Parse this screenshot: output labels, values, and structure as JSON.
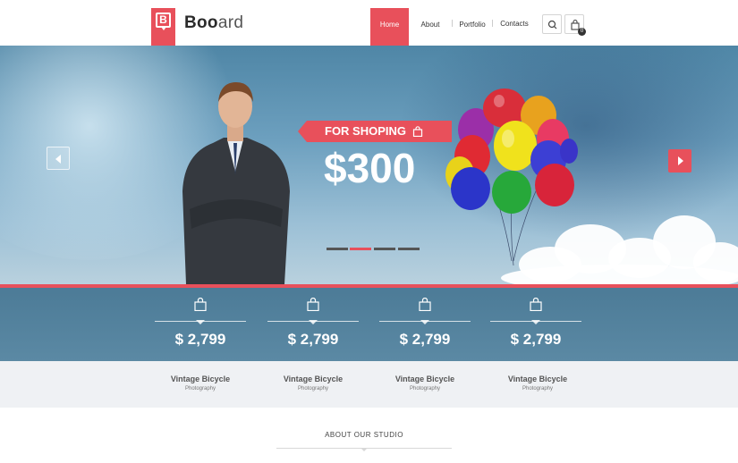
{
  "brand": {
    "name_bold": "Boo",
    "name_light": "ard",
    "logo_letter": "B"
  },
  "nav": {
    "items": [
      {
        "label": "Home",
        "active": true
      },
      {
        "label": "About",
        "active": false
      },
      {
        "label": "Portfolio",
        "active": false
      },
      {
        "label": "Contacts",
        "active": false
      }
    ],
    "search_icon": "search-icon",
    "cart_icon": "cart-icon",
    "cart_count": "0"
  },
  "hero": {
    "ribbon_text": "FOR SHOPING",
    "price": "$300",
    "slide_count": 4,
    "active_slide": 2
  },
  "products": [
    {
      "price": "$ 2,799",
      "title": "Vintage Bicycle",
      "category": "Photography"
    },
    {
      "price": "$ 2,799",
      "title": "Vintage Bicycle",
      "category": "Photography"
    },
    {
      "price": "$ 2,799",
      "title": "Vintage Bicycle",
      "category": "Photography"
    },
    {
      "price": "$ 2,799",
      "title": "Vintage Bicycle",
      "category": "Photography"
    }
  ],
  "about": {
    "title": "ABOUT OUR STUDIO"
  },
  "colors": {
    "accent": "#e8505b",
    "band": "#5b89a4",
    "labels_bg": "#eff1f4"
  }
}
